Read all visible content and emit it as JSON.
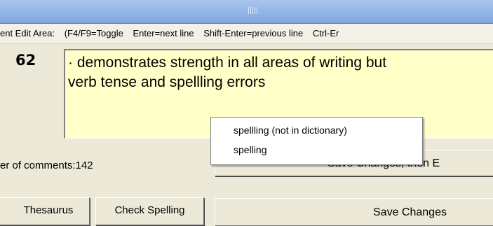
{
  "hint_bar": {
    "segments": [
      "ent Edit Area:",
      "(F4/F9=Toggle",
      "Enter=next line",
      "Shift-Enter=previous line",
      "Ctrl-Er"
    ]
  },
  "comment": {
    "number": "62",
    "text_line1": "· demonstrates strength in all areas of writing but",
    "text_line2": "verb tense and spellling errors"
  },
  "spell_popup": {
    "items": [
      "spellling (not in dictionary)",
      "spelling"
    ]
  },
  "status": {
    "comment_count": "er of comments:142"
  },
  "buttons": {
    "save_exit": "Save Changes, then E",
    "save": "Save Changes",
    "thesaurus": "Thesaurus",
    "check_spelling": "Check Spelling"
  },
  "colors": {
    "editor_bg": "#FFFFC8",
    "window_bg": "#ECE9D8",
    "splitter": "#8FB1E6"
  }
}
